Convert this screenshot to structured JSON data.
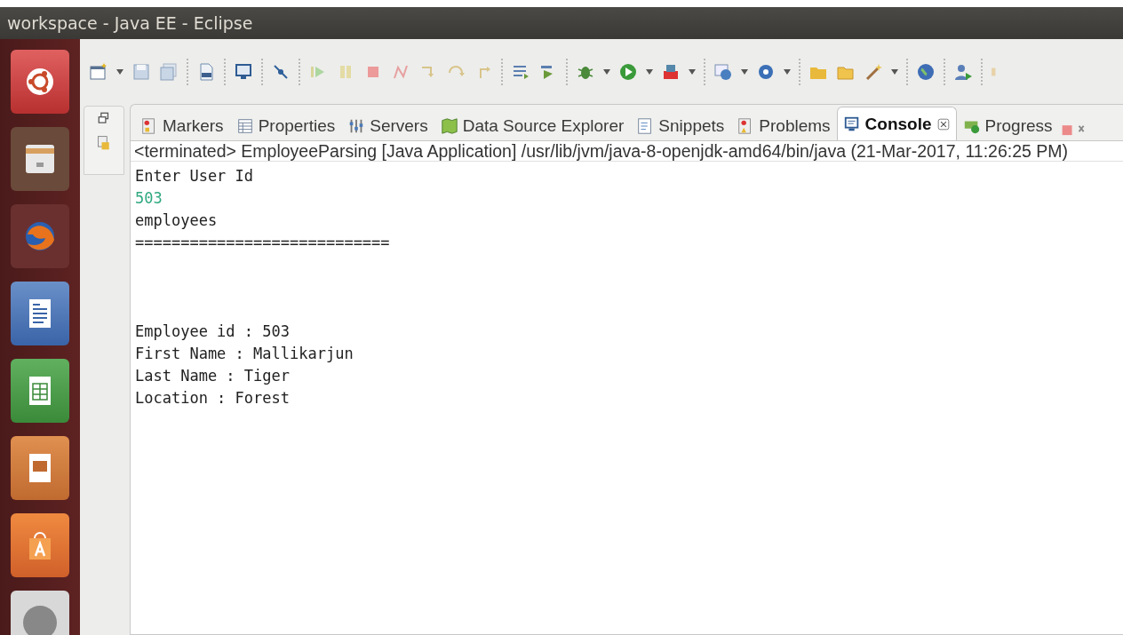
{
  "window": {
    "title": "workspace - Java EE - Eclipse"
  },
  "tabs": [
    {
      "label": "Markers",
      "selected": false
    },
    {
      "label": "Properties",
      "selected": false
    },
    {
      "label": "Servers",
      "selected": false
    },
    {
      "label": "Data Source Explorer",
      "selected": false
    },
    {
      "label": "Snippets",
      "selected": false
    },
    {
      "label": "Problems",
      "selected": false
    },
    {
      "label": "Console",
      "selected": true
    },
    {
      "label": "Progress",
      "selected": false
    }
  ],
  "console": {
    "description": "<terminated> EmployeeParsing [Java Application] /usr/lib/jvm/java-8-openjdk-amd64/bin/java (21-Mar-2017, 11:26:25 PM)",
    "lines": [
      {
        "kind": "output",
        "text": "Enter User Id"
      },
      {
        "kind": "input",
        "text": "503"
      },
      {
        "kind": "output",
        "text": "employees"
      },
      {
        "kind": "output",
        "text": "============================"
      },
      {
        "kind": "blank"
      },
      {
        "kind": "blank"
      },
      {
        "kind": "blank"
      },
      {
        "kind": "output",
        "text": "Employee id : 503"
      },
      {
        "kind": "output",
        "text": "First Name : Mallikarjun"
      },
      {
        "kind": "output",
        "text": "Last Name : Tiger"
      },
      {
        "kind": "output",
        "text": "Location : Forest"
      }
    ]
  }
}
